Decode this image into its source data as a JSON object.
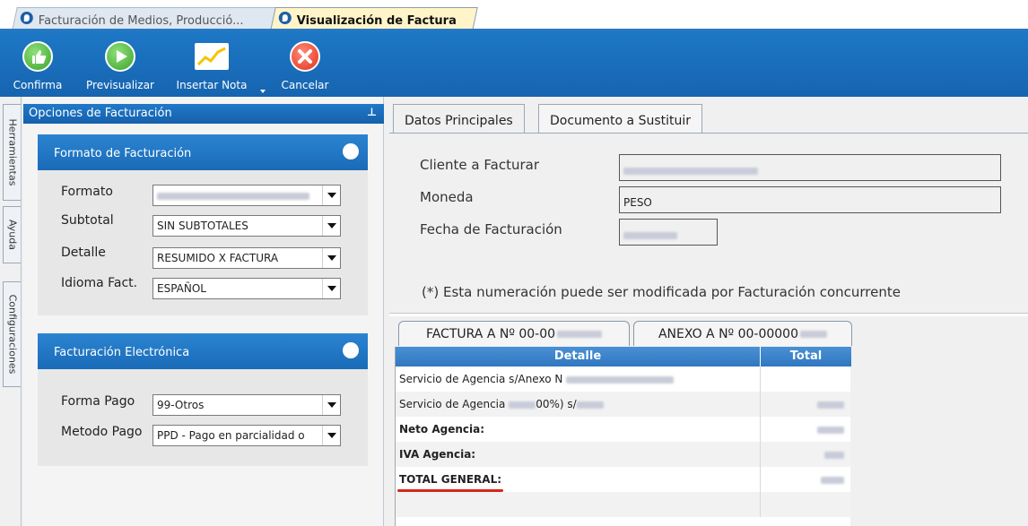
{
  "tabs": {
    "inactive_label": "Facturación de Medios, Producció...",
    "active_label": "Visualización de Factura"
  },
  "toolbar": {
    "confirm_label": "Confirma",
    "preview_label": "Previsualizar",
    "insert_note_label": "Insertar Nota",
    "cancel_label": "Cancelar"
  },
  "side_tabs": [
    "Herramientas",
    "Ayuda",
    "Configuraciones"
  ],
  "left_panel": {
    "title": "Opciones de Facturación",
    "format_group": {
      "title": "Formato de Facturación",
      "fields": [
        {
          "label": "Formato",
          "value": ""
        },
        {
          "label": "Subtotal",
          "value": "SIN SUBTOTALES"
        },
        {
          "label": "Detalle",
          "value": "RESUMIDO X FACTURA"
        },
        {
          "label": "Idioma Fact.",
          "value": "ESPAÑOL"
        }
      ]
    },
    "electronic_group": {
      "title": "Facturación Electrónica",
      "fields": [
        {
          "label": "Forma Pago",
          "value": "99-Otros"
        },
        {
          "label": "Metodo Pago",
          "value": "PPD - Pago en parcialidad o"
        }
      ]
    }
  },
  "right": {
    "tabs": [
      "Datos Principales",
      "Documento a Sustituir"
    ],
    "fields": [
      {
        "label": "Cliente a Facturar",
        "value": ""
      },
      {
        "label": "Moneda",
        "value": "PESO"
      },
      {
        "label": "Fecha de Facturación",
        "value": ""
      }
    ],
    "note": "(*) Esta numeración puede ser modificada por Facturación concurrente",
    "bottom_tabs": [
      "FACTURA A Nº 00-00",
      "ANEXO A Nº 00-00000"
    ],
    "grid": {
      "columns": [
        "Detalle",
        "Total"
      ],
      "rows": [
        {
          "detail": "Servicio de Agencia s/Anexo N",
          "bold": false
        },
        {
          "detail": "Servicio de Agencia",
          "detail_mid": "00%) s/",
          "bold": false
        },
        {
          "detail": "Neto Agencia:",
          "bold": true
        },
        {
          "detail": "IVA Agencia:",
          "bold": true
        },
        {
          "detail": "TOTAL GENERAL:",
          "bold": true
        }
      ]
    }
  },
  "colors": {
    "toolbar_blue": "#1e78c6",
    "active_tab": "#fff5c8",
    "highlight_red": "#d7261b"
  }
}
